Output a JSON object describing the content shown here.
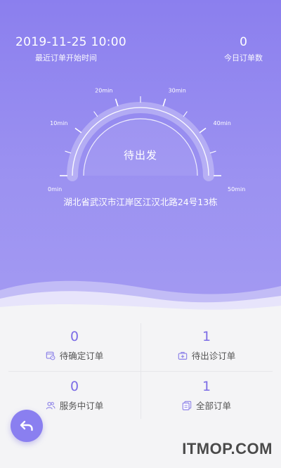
{
  "header": {
    "last_order_time": "2019-11-25 10:00",
    "last_order_label": "最近订单开始时间",
    "today_count": "0",
    "today_label": "今日订单数"
  },
  "gauge": {
    "ticks": [
      "0min",
      "10min",
      "20min",
      "30min",
      "40min",
      "50min"
    ],
    "status": "待出发"
  },
  "address": "湖北省武汉市江岸区江汉北路24号13栋",
  "orders": [
    {
      "count": "0",
      "label": "待确定订单",
      "icon": "calendar-clock-icon"
    },
    {
      "count": "1",
      "label": "待出诊订单",
      "icon": "medical-kit-icon"
    },
    {
      "count": "0",
      "label": "服务中订单",
      "icon": "users-icon"
    },
    {
      "count": "1",
      "label": "全部订单",
      "icon": "documents-icon"
    }
  ],
  "watermark": "ITMOP.COM",
  "colors": {
    "primary": "#8b7fee",
    "accent_text": "#7c6ce6"
  }
}
